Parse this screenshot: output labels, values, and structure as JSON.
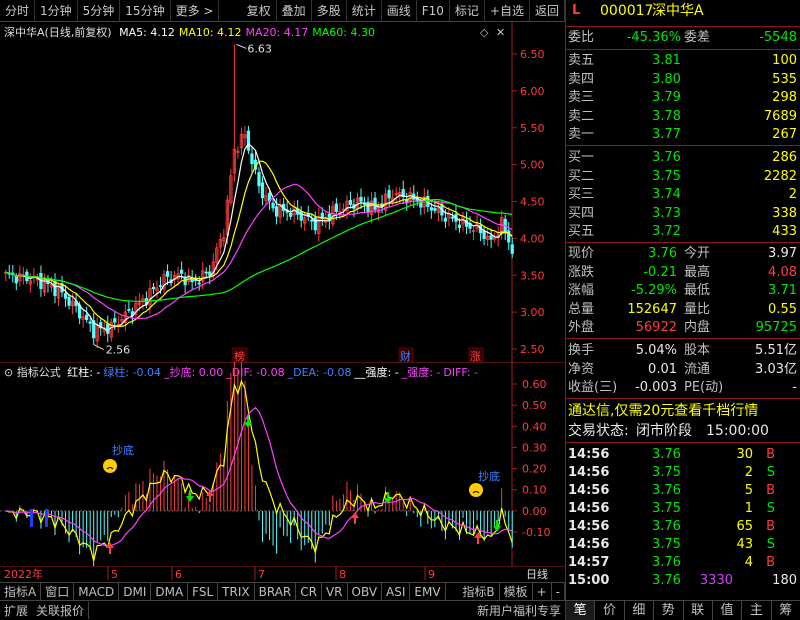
{
  "toolbar": {
    "left": [
      "分时",
      "1分钟",
      "5分钟",
      "15分钟",
      "更多 >"
    ],
    "right": [
      "复权",
      "叠加",
      "多股",
      "统计",
      "画线",
      "F10",
      "标记",
      "+自选",
      "返回"
    ]
  },
  "main": {
    "stock_label": "深中华A(日线,前复权)",
    "ma": [
      {
        "label": "MA5: 4.12",
        "color": "#ffffff"
      },
      {
        "label": "MA10: 4.12",
        "color": "#ffff00"
      },
      {
        "label": "MA20: 4.17",
        "color": "#ff40ff"
      },
      {
        "label": "MA60: 4.30",
        "color": "#00ff00"
      }
    ],
    "high_label": "6.63",
    "low_label": "2.56",
    "price_ticks": [
      "6.50",
      "6.00",
      "5.50",
      "5.00",
      "4.50",
      "4.00",
      "3.50",
      "3.00",
      "2.50"
    ],
    "markers": [
      "榜",
      "财",
      "涨"
    ]
  },
  "indicator": {
    "label": "指标公式",
    "items": [
      {
        "label": "红柱: -",
        "color": "#ffffff"
      },
      {
        "label": "绿柱: -0.04",
        "color": "#4080ff"
      },
      {
        "label": "_抄底: 0.00",
        "color": "#ff40ff"
      },
      {
        "label": "_DIF: -0.08",
        "color": "#ff40ff"
      },
      {
        "label": "_DEA: -0.08",
        "color": "#4080ff"
      },
      {
        "label": "__强度: -",
        "color": "#ffffff"
      },
      {
        "label": "_强度: -",
        "color": "#ff40ff"
      },
      {
        "label": "DIFF: -",
        "color": "#ff40ff"
      }
    ],
    "ticks": [
      "0.60",
      "0.50",
      "0.40",
      "0.30",
      "0.20",
      "0.10",
      "0.00",
      "-0.10"
    ],
    "signal1": "抄底",
    "signal2": "抄底"
  },
  "dates": {
    "year": "2022年",
    "months": [
      "5",
      "6",
      "7",
      "8",
      "9"
    ],
    "period": "日线"
  },
  "tabs": [
    "指标A",
    "窗口",
    "MACD",
    "DMI",
    "DMA",
    "FSL",
    "TRIX",
    "BRAR",
    "CR",
    "VR",
    "OBV",
    "ASI",
    "EMV",
    "指标B",
    "模板",
    "+",
    "-"
  ],
  "status": {
    "left": [
      "扩展",
      "关联报价"
    ],
    "right": "新用户福利专享"
  },
  "quote": {
    "mark": "L",
    "code": "000017",
    "name": "深中华A",
    "weibi_label": "委比",
    "weibi": "-45.36%",
    "weicha_label": "委差",
    "weicha": "-5548",
    "asks": [
      {
        "label": "卖五",
        "price": "3.81",
        "vol": "100"
      },
      {
        "label": "卖四",
        "price": "3.80",
        "vol": "535"
      },
      {
        "label": "卖三",
        "price": "3.79",
        "vol": "298"
      },
      {
        "label": "卖二",
        "price": "3.78",
        "vol": "7689"
      },
      {
        "label": "卖一",
        "price": "3.77",
        "vol": "267"
      }
    ],
    "bids": [
      {
        "label": "买一",
        "price": "3.76",
        "vol": "286"
      },
      {
        "label": "买二",
        "price": "3.75",
        "vol": "2282"
      },
      {
        "label": "买三",
        "price": "3.74",
        "vol": "2"
      },
      {
        "label": "买四",
        "price": "3.73",
        "vol": "338"
      },
      {
        "label": "买五",
        "price": "3.72",
        "vol": "433"
      }
    ],
    "stats": [
      {
        "l1": "现价",
        "v1": "3.76",
        "c1": "green",
        "l2": "今开",
        "v2": "3.97",
        "c2": "white"
      },
      {
        "l1": "涨跌",
        "v1": "-0.21",
        "c1": "green",
        "l2": "最高",
        "v2": "4.08",
        "c2": "red"
      },
      {
        "l1": "涨幅",
        "v1": "-5.29%",
        "c1": "green",
        "l2": "最低",
        "v2": "3.71",
        "c2": "green"
      },
      {
        "l1": "总量",
        "v1": "152647",
        "c1": "yellow",
        "l2": "量比",
        "v2": "0.55",
        "c2": "yellow"
      },
      {
        "l1": "外盘",
        "v1": "56922",
        "c1": "red",
        "l2": "内盘",
        "v2": "95725",
        "c2": "green"
      }
    ],
    "stats2": [
      {
        "l1": "换手",
        "v1": "5.04%",
        "l2": "股本",
        "v2": "5.51亿"
      },
      {
        "l1": "净资",
        "v1": "0.01",
        "l2": "流通",
        "v2": "3.03亿"
      },
      {
        "l1": "收益(三)",
        "v1": "-0.003",
        "l2": "PE(动)",
        "v2": "-"
      }
    ],
    "ad": "通达信,仅需20元查看千档行情",
    "trade_status_label": "交易状态:",
    "trade_status": "闭市阶段",
    "trade_time": "15:00:00",
    "ticks": [
      {
        "time": "14:56",
        "price": "3.76",
        "vol": "30",
        "bs": "B"
      },
      {
        "time": "14:56",
        "price": "3.75",
        "vol": "2",
        "bs": "S"
      },
      {
        "time": "14:56",
        "price": "3.76",
        "vol": "5",
        "bs": "B"
      },
      {
        "time": "14:56",
        "price": "3.75",
        "vol": "1",
        "bs": "S"
      },
      {
        "time": "14:56",
        "price": "3.76",
        "vol": "65",
        "bs": "B"
      },
      {
        "time": "14:56",
        "price": "3.75",
        "vol": "43",
        "bs": "S"
      },
      {
        "time": "14:57",
        "price": "3.76",
        "vol": "4",
        "bs": "B"
      },
      {
        "time": "15:00",
        "price": "3.76",
        "vol": "3330",
        "bs": "180"
      }
    ],
    "tabs": [
      "笔",
      "价",
      "细",
      "势",
      "联",
      "值",
      "主",
      "筹"
    ]
  }
}
